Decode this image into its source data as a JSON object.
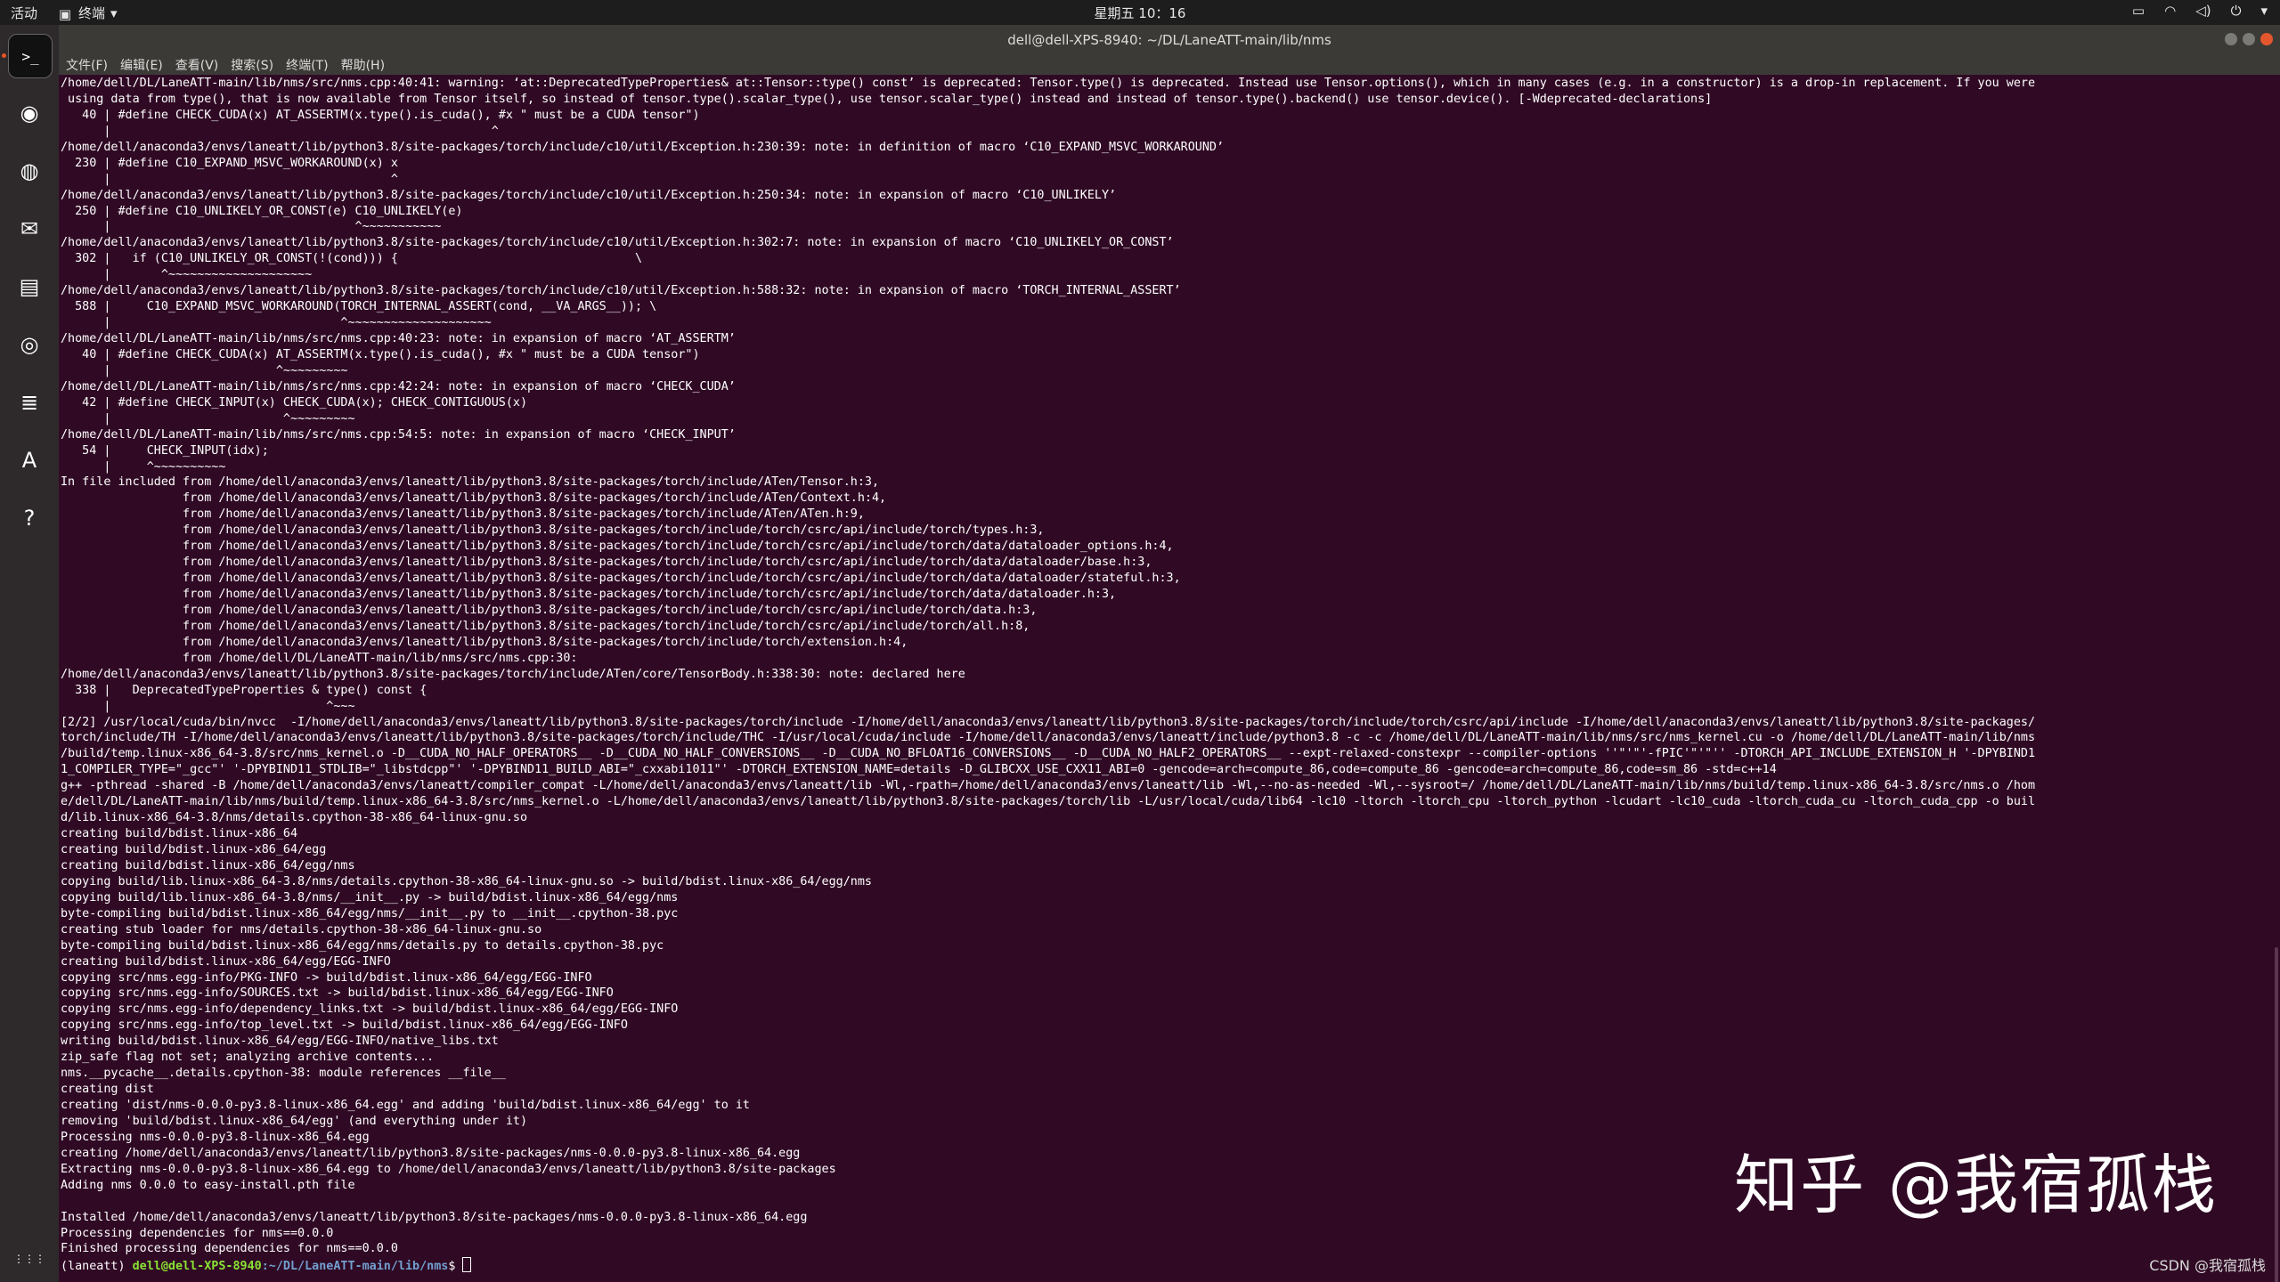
{
  "topbar": {
    "activities": "活动",
    "app_name": "终端",
    "clock": "星期五 10：16"
  },
  "window": {
    "title": "dell@dell-XPS-8940: ~/DL/LaneATT-main/lib/nms"
  },
  "menu": [
    "文件(F)",
    "编辑(E)",
    "查看(V)",
    "搜索(S)",
    "终端(T)",
    "帮助(H)"
  ],
  "dock": [
    {
      "icon": "terminal-icon",
      "glyph": ">_"
    },
    {
      "icon": "chrome-icon",
      "glyph": "◉"
    },
    {
      "icon": "firefox-icon",
      "glyph": "◍"
    },
    {
      "icon": "thunderbird-icon",
      "glyph": "✉"
    },
    {
      "icon": "files-icon",
      "glyph": "▤"
    },
    {
      "icon": "rhythmbox-icon",
      "glyph": "◎"
    },
    {
      "icon": "writer-icon",
      "glyph": "≣"
    },
    {
      "icon": "software-center-icon",
      "glyph": "A"
    },
    {
      "icon": "help-icon",
      "glyph": "?"
    },
    {
      "icon": "show-apps-icon",
      "glyph": "⋮⋮⋮"
    }
  ],
  "terminal": {
    "lines": [
      "/home/dell/DL/LaneATT-main/lib/nms/src/nms.cpp:40:41: warning: ‘at::DeprecatedTypeProperties& at::Tensor::type() const’ is deprecated: Tensor.type() is deprecated. Instead use Tensor.options(), which in many cases (e.g. in a constructor) is a drop-in replacement. If you were",
      " using data from type(), that is now available from Tensor itself, so instead of tensor.type().scalar_type(), use tensor.scalar_type() instead and instead of tensor.type().backend() use tensor.device(). [-Wdeprecated-declarations]",
      "   40 | #define CHECK_CUDA(x) AT_ASSERTM(x.type().is_cuda(), #x \" must be a CUDA tensor\")",
      "      |                                                     ^",
      "/home/dell/anaconda3/envs/laneatt/lib/python3.8/site-packages/torch/include/c10/util/Exception.h:230:39: note: in definition of macro ‘C10_EXPAND_MSVC_WORKAROUND’",
      "  230 | #define C10_EXPAND_MSVC_WORKAROUND(x) x",
      "      |                                       ^",
      "/home/dell/anaconda3/envs/laneatt/lib/python3.8/site-packages/torch/include/c10/util/Exception.h:250:34: note: in expansion of macro ‘C10_UNLIKELY’",
      "  250 | #define C10_UNLIKELY_OR_CONST(e) C10_UNLIKELY(e)",
      "      |                                  ^~~~~~~~~~~~",
      "/home/dell/anaconda3/envs/laneatt/lib/python3.8/site-packages/torch/include/c10/util/Exception.h:302:7: note: in expansion of macro ‘C10_UNLIKELY_OR_CONST’",
      "  302 |   if (C10_UNLIKELY_OR_CONST(!(cond))) {                                 \\",
      "      |       ^~~~~~~~~~~~~~~~~~~~~",
      "/home/dell/anaconda3/envs/laneatt/lib/python3.8/site-packages/torch/include/c10/util/Exception.h:588:32: note: in expansion of macro ‘TORCH_INTERNAL_ASSERT’",
      "  588 |     C10_EXPAND_MSVC_WORKAROUND(TORCH_INTERNAL_ASSERT(cond, __VA_ARGS__)); \\",
      "      |                                ^~~~~~~~~~~~~~~~~~~~~",
      "/home/dell/DL/LaneATT-main/lib/nms/src/nms.cpp:40:23: note: in expansion of macro ‘AT_ASSERTM’",
      "   40 | #define CHECK_CUDA(x) AT_ASSERTM(x.type().is_cuda(), #x \" must be a CUDA tensor\")",
      "      |                       ^~~~~~~~~~",
      "/home/dell/DL/LaneATT-main/lib/nms/src/nms.cpp:42:24: note: in expansion of macro ‘CHECK_CUDA’",
      "   42 | #define CHECK_INPUT(x) CHECK_CUDA(x); CHECK_CONTIGUOUS(x)",
      "      |                        ^~~~~~~~~~",
      "/home/dell/DL/LaneATT-main/lib/nms/src/nms.cpp:54:5: note: in expansion of macro ‘CHECK_INPUT’",
      "   54 |     CHECK_INPUT(idx);",
      "      |     ^~~~~~~~~~~",
      "In file included from /home/dell/anaconda3/envs/laneatt/lib/python3.8/site-packages/torch/include/ATen/Tensor.h:3,",
      "                 from /home/dell/anaconda3/envs/laneatt/lib/python3.8/site-packages/torch/include/ATen/Context.h:4,",
      "                 from /home/dell/anaconda3/envs/laneatt/lib/python3.8/site-packages/torch/include/ATen/ATen.h:9,",
      "                 from /home/dell/anaconda3/envs/laneatt/lib/python3.8/site-packages/torch/include/torch/csrc/api/include/torch/types.h:3,",
      "                 from /home/dell/anaconda3/envs/laneatt/lib/python3.8/site-packages/torch/include/torch/csrc/api/include/torch/data/dataloader_options.h:4,",
      "                 from /home/dell/anaconda3/envs/laneatt/lib/python3.8/site-packages/torch/include/torch/csrc/api/include/torch/data/dataloader/base.h:3,",
      "                 from /home/dell/anaconda3/envs/laneatt/lib/python3.8/site-packages/torch/include/torch/csrc/api/include/torch/data/dataloader/stateful.h:3,",
      "                 from /home/dell/anaconda3/envs/laneatt/lib/python3.8/site-packages/torch/include/torch/csrc/api/include/torch/data/dataloader.h:3,",
      "                 from /home/dell/anaconda3/envs/laneatt/lib/python3.8/site-packages/torch/include/torch/csrc/api/include/torch/data.h:3,",
      "                 from /home/dell/anaconda3/envs/laneatt/lib/python3.8/site-packages/torch/include/torch/csrc/api/include/torch/all.h:8,",
      "                 from /home/dell/anaconda3/envs/laneatt/lib/python3.8/site-packages/torch/include/torch/extension.h:4,",
      "                 from /home/dell/DL/LaneATT-main/lib/nms/src/nms.cpp:30:",
      "/home/dell/anaconda3/envs/laneatt/lib/python3.8/site-packages/torch/include/ATen/core/TensorBody.h:338:30: note: declared here",
      "  338 |   DeprecatedTypeProperties & type() const {",
      "      |                              ^~~~",
      "[2/2] /usr/local/cuda/bin/nvcc  -I/home/dell/anaconda3/envs/laneatt/lib/python3.8/site-packages/torch/include -I/home/dell/anaconda3/envs/laneatt/lib/python3.8/site-packages/torch/include/torch/csrc/api/include -I/home/dell/anaconda3/envs/laneatt/lib/python3.8/site-packages/",
      "torch/include/TH -I/home/dell/anaconda3/envs/laneatt/lib/python3.8/site-packages/torch/include/THC -I/usr/local/cuda/include -I/home/dell/anaconda3/envs/laneatt/include/python3.8 -c -c /home/dell/DL/LaneATT-main/lib/nms/src/nms_kernel.cu -o /home/dell/DL/LaneATT-main/lib/nms",
      "/build/temp.linux-x86_64-3.8/src/nms_kernel.o -D__CUDA_NO_HALF_OPERATORS__ -D__CUDA_NO_HALF_CONVERSIONS__ -D__CUDA_NO_BFLOAT16_CONVERSIONS__ -D__CUDA_NO_HALF2_OPERATORS__ --expt-relaxed-constexpr --compiler-options ''\"'\"'-fPIC'\"'\"'' -DTORCH_API_INCLUDE_EXTENSION_H '-DPYBIND1",
      "1_COMPILER_TYPE=\"_gcc\"' '-DPYBIND11_STDLIB=\"_libstdcpp\"' '-DPYBIND11_BUILD_ABI=\"_cxxabi1011\"' -DTORCH_EXTENSION_NAME=details -D_GLIBCXX_USE_CXX11_ABI=0 -gencode=arch=compute_86,code=compute_86 -gencode=arch=compute_86,code=sm_86 -std=c++14",
      "g++ -pthread -shared -B /home/dell/anaconda3/envs/laneatt/compiler_compat -L/home/dell/anaconda3/envs/laneatt/lib -Wl,-rpath=/home/dell/anaconda3/envs/laneatt/lib -Wl,--no-as-needed -Wl,--sysroot=/ /home/dell/DL/LaneATT-main/lib/nms/build/temp.linux-x86_64-3.8/src/nms.o /hom",
      "e/dell/DL/LaneATT-main/lib/nms/build/temp.linux-x86_64-3.8/src/nms_kernel.o -L/home/dell/anaconda3/envs/laneatt/lib/python3.8/site-packages/torch/lib -L/usr/local/cuda/lib64 -lc10 -ltorch -ltorch_cpu -ltorch_python -lcudart -lc10_cuda -ltorch_cuda_cu -ltorch_cuda_cpp -o buil",
      "d/lib.linux-x86_64-3.8/nms/details.cpython-38-x86_64-linux-gnu.so",
      "creating build/bdist.linux-x86_64",
      "creating build/bdist.linux-x86_64/egg",
      "creating build/bdist.linux-x86_64/egg/nms",
      "copying build/lib.linux-x86_64-3.8/nms/details.cpython-38-x86_64-linux-gnu.so -> build/bdist.linux-x86_64/egg/nms",
      "copying build/lib.linux-x86_64-3.8/nms/__init__.py -> build/bdist.linux-x86_64/egg/nms",
      "byte-compiling build/bdist.linux-x86_64/egg/nms/__init__.py to __init__.cpython-38.pyc",
      "creating stub loader for nms/details.cpython-38-x86_64-linux-gnu.so",
      "byte-compiling build/bdist.linux-x86_64/egg/nms/details.py to details.cpython-38.pyc",
      "creating build/bdist.linux-x86_64/egg/EGG-INFO",
      "copying src/nms.egg-info/PKG-INFO -> build/bdist.linux-x86_64/egg/EGG-INFO",
      "copying src/nms.egg-info/SOURCES.txt -> build/bdist.linux-x86_64/egg/EGG-INFO",
      "copying src/nms.egg-info/dependency_links.txt -> build/bdist.linux-x86_64/egg/EGG-INFO",
      "copying src/nms.egg-info/top_level.txt -> build/bdist.linux-x86_64/egg/EGG-INFO",
      "writing build/bdist.linux-x86_64/egg/EGG-INFO/native_libs.txt",
      "zip_safe flag not set; analyzing archive contents...",
      "nms.__pycache__.details.cpython-38: module references __file__",
      "creating dist",
      "creating 'dist/nms-0.0.0-py3.8-linux-x86_64.egg' and adding 'build/bdist.linux-x86_64/egg' to it",
      "removing 'build/bdist.linux-x86_64/egg' (and everything under it)",
      "Processing nms-0.0.0-py3.8-linux-x86_64.egg",
      "creating /home/dell/anaconda3/envs/laneatt/lib/python3.8/site-packages/nms-0.0.0-py3.8-linux-x86_64.egg",
      "Extracting nms-0.0.0-py3.8-linux-x86_64.egg to /home/dell/anaconda3/envs/laneatt/lib/python3.8/site-packages",
      "Adding nms 0.0.0 to easy-install.pth file",
      "",
      "Installed /home/dell/anaconda3/envs/laneatt/lib/python3.8/site-packages/nms-0.0.0-py3.8-linux-x86_64.egg",
      "Processing dependencies for nms==0.0.0",
      "Finished processing dependencies for nms==0.0.0"
    ],
    "prompt": {
      "env": "(laneatt) ",
      "user_host": "dell@dell-XPS-8940",
      "path": ":~/DL/LaneATT-main/lib/nms",
      "symbol": "$ "
    }
  },
  "watermark": "知乎 @我宿孤栈",
  "credit": "CSDN @我宿孤栈",
  "colors": {
    "terminal_bg": "#300a24",
    "prompt_user": "#8ae234",
    "prompt_path": "#729fcf",
    "topbar_bg": "#1d1d1d"
  }
}
